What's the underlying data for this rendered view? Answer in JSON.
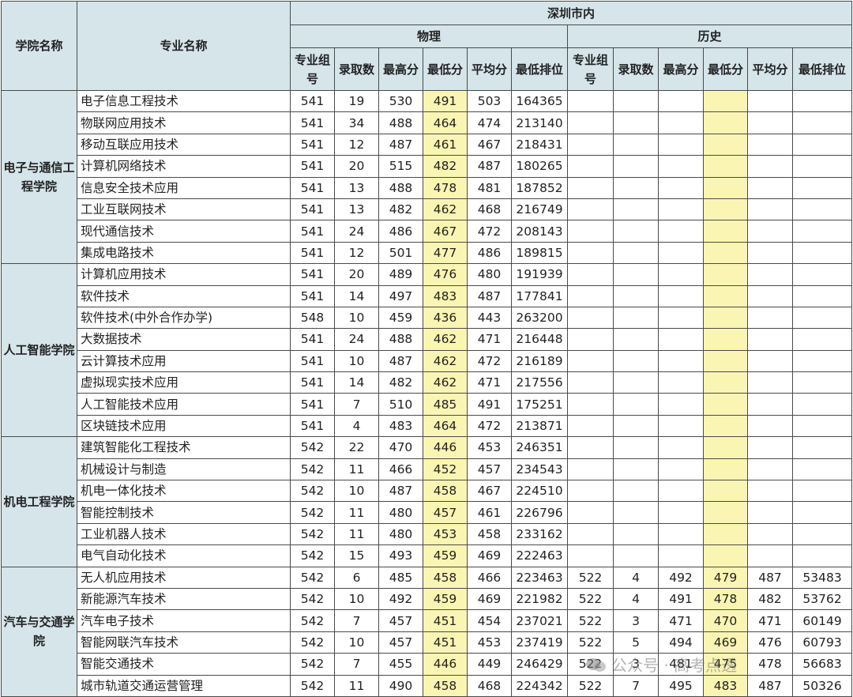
{
  "header": {
    "college": "学院名称",
    "major": "专业名称",
    "region": "深圳市内",
    "physics": "物理",
    "history": "历史",
    "columns": [
      "专业组号",
      "录取数",
      "最高分",
      "最低分",
      "平均分",
      "最低排位"
    ]
  },
  "colleges": [
    {
      "name": "电子与通信工程学院",
      "rows": [
        {
          "major": "电子信息工程技术",
          "physics": [
            "541",
            "19",
            "530",
            "491",
            "503",
            "164365"
          ],
          "history": [
            "",
            "",
            "",
            "",
            "",
            ""
          ]
        },
        {
          "major": "物联网应用技术",
          "physics": [
            "541",
            "34",
            "488",
            "464",
            "474",
            "213140"
          ],
          "history": [
            "",
            "",
            "",
            "",
            "",
            ""
          ]
        },
        {
          "major": "移动互联应用技术",
          "physics": [
            "541",
            "12",
            "487",
            "461",
            "467",
            "218431"
          ],
          "history": [
            "",
            "",
            "",
            "",
            "",
            ""
          ]
        },
        {
          "major": "计算机网络技术",
          "physics": [
            "541",
            "20",
            "515",
            "482",
            "487",
            "180265"
          ],
          "history": [
            "",
            "",
            "",
            "",
            "",
            ""
          ]
        },
        {
          "major": "信息安全技术应用",
          "physics": [
            "541",
            "13",
            "488",
            "478",
            "481",
            "187852"
          ],
          "history": [
            "",
            "",
            "",
            "",
            "",
            ""
          ]
        },
        {
          "major": "工业互联网技术",
          "physics": [
            "541",
            "13",
            "482",
            "462",
            "468",
            "216749"
          ],
          "history": [
            "",
            "",
            "",
            "",
            "",
            ""
          ]
        },
        {
          "major": "现代通信技术",
          "physics": [
            "541",
            "24",
            "486",
            "467",
            "472",
            "208143"
          ],
          "history": [
            "",
            "",
            "",
            "",
            "",
            ""
          ]
        },
        {
          "major": "集成电路技术",
          "physics": [
            "541",
            "12",
            "501",
            "477",
            "486",
            "189815"
          ],
          "history": [
            "",
            "",
            "",
            "",
            "",
            ""
          ]
        }
      ]
    },
    {
      "name": "人工智能学院",
      "rows": [
        {
          "major": "计算机应用技术",
          "physics": [
            "541",
            "20",
            "489",
            "476",
            "480",
            "191939"
          ],
          "history": [
            "",
            "",
            "",
            "",
            "",
            ""
          ]
        },
        {
          "major": "软件技术",
          "physics": [
            "541",
            "14",
            "497",
            "483",
            "487",
            "177841"
          ],
          "history": [
            "",
            "",
            "",
            "",
            "",
            ""
          ]
        },
        {
          "major": "软件技术(中外合作办学)",
          "physics": [
            "548",
            "10",
            "459",
            "436",
            "443",
            "263200"
          ],
          "history": [
            "",
            "",
            "",
            "",
            "",
            ""
          ]
        },
        {
          "major": "大数据技术",
          "physics": [
            "541",
            "24",
            "488",
            "462",
            "471",
            "216448"
          ],
          "history": [
            "",
            "",
            "",
            "",
            "",
            ""
          ]
        },
        {
          "major": "云计算技术应用",
          "physics": [
            "541",
            "10",
            "487",
            "462",
            "472",
            "216189"
          ],
          "history": [
            "",
            "",
            "",
            "",
            "",
            ""
          ]
        },
        {
          "major": "虚拟现实技术应用",
          "physics": [
            "541",
            "14",
            "482",
            "462",
            "471",
            "217556"
          ],
          "history": [
            "",
            "",
            "",
            "",
            "",
            ""
          ]
        },
        {
          "major": "人工智能技术应用",
          "physics": [
            "541",
            "7",
            "510",
            "485",
            "491",
            "175251"
          ],
          "history": [
            "",
            "",
            "",
            "",
            "",
            ""
          ]
        },
        {
          "major": "区块链技术应用",
          "physics": [
            "541",
            "4",
            "483",
            "464",
            "472",
            "213871"
          ],
          "history": [
            "",
            "",
            "",
            "",
            "",
            ""
          ]
        }
      ]
    },
    {
      "name": "机电工程学院",
      "rows": [
        {
          "major": "建筑智能化工程技术",
          "physics": [
            "542",
            "22",
            "470",
            "446",
            "453",
            "246351"
          ],
          "history": [
            "",
            "",
            "",
            "",
            "",
            ""
          ]
        },
        {
          "major": "机械设计与制造",
          "physics": [
            "542",
            "11",
            "466",
            "452",
            "457",
            "234543"
          ],
          "history": [
            "",
            "",
            "",
            "",
            "",
            ""
          ]
        },
        {
          "major": "机电一体化技术",
          "physics": [
            "542",
            "10",
            "487",
            "458",
            "467",
            "224510"
          ],
          "history": [
            "",
            "",
            "",
            "",
            "",
            ""
          ]
        },
        {
          "major": "智能控制技术",
          "physics": [
            "542",
            "11",
            "480",
            "457",
            "461",
            "226796"
          ],
          "history": [
            "",
            "",
            "",
            "",
            "",
            ""
          ]
        },
        {
          "major": "工业机器人技术",
          "physics": [
            "542",
            "11",
            "480",
            "453",
            "458",
            "233162"
          ],
          "history": [
            "",
            "",
            "",
            "",
            "",
            ""
          ]
        },
        {
          "major": "电气自动化技术",
          "physics": [
            "542",
            "15",
            "493",
            "459",
            "469",
            "222463"
          ],
          "history": [
            "",
            "",
            "",
            "",
            "",
            ""
          ]
        }
      ]
    },
    {
      "name": "汽车与交通学院",
      "rows": [
        {
          "major": "无人机应用技术",
          "physics": [
            "542",
            "6",
            "485",
            "458",
            "466",
            "223463"
          ],
          "history": [
            "522",
            "4",
            "492",
            "479",
            "487",
            "53483"
          ]
        },
        {
          "major": "新能源汽车技术",
          "physics": [
            "542",
            "10",
            "492",
            "459",
            "469",
            "221982"
          ],
          "history": [
            "522",
            "4",
            "491",
            "478",
            "482",
            "53762"
          ]
        },
        {
          "major": "汽车电子技术",
          "physics": [
            "542",
            "7",
            "457",
            "451",
            "454",
            "237021"
          ],
          "history": [
            "522",
            "3",
            "471",
            "470",
            "471",
            "60149"
          ]
        },
        {
          "major": "智能网联汽车技术",
          "physics": [
            "542",
            "10",
            "457",
            "451",
            "453",
            "237419"
          ],
          "history": [
            "522",
            "5",
            "494",
            "469",
            "476",
            "60793"
          ]
        },
        {
          "major": "智能交通技术",
          "physics": [
            "542",
            "7",
            "455",
            "446",
            "449",
            "246429"
          ],
          "history": [
            "522",
            "3",
            "481",
            "475",
            "478",
            "56683"
          ]
        },
        {
          "major": "城市轨道交通运营管理",
          "physics": [
            "542",
            "11",
            "490",
            "458",
            "468",
            "224342"
          ],
          "history": [
            "522",
            "7",
            "495",
            "483",
            "487",
            "50326"
          ]
        }
      ]
    }
  ],
  "watermark": "公众号 · 高考点透",
  "colors": {
    "header_bg": "#d5e5ea",
    "highlight": "#fbf5b4",
    "border": "#4a4a4a"
  }
}
